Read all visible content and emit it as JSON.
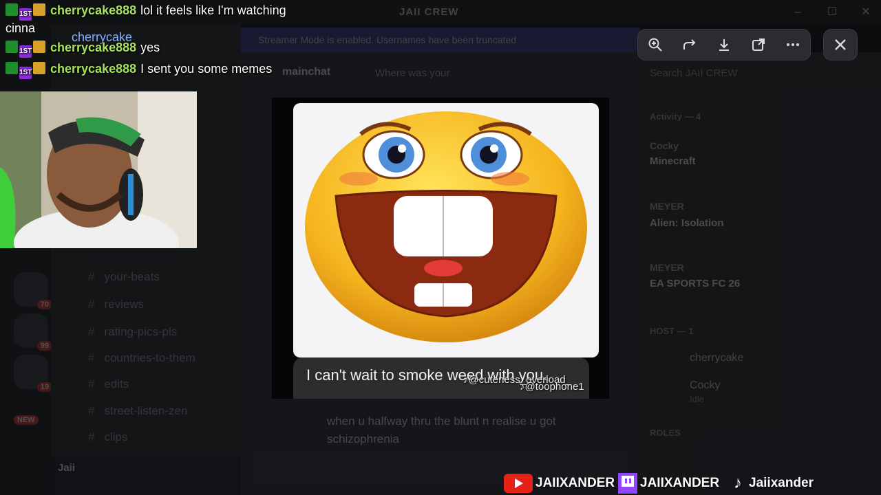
{
  "discord": {
    "app_title": "JAII CREW",
    "banner": "Streamer Mode is enabled. Usernames have been truncated",
    "chat_title": "mainchat",
    "chat_topic": "Where was your",
    "channels": [
      "your-beats",
      "reviews",
      "rating-pics-pls",
      "countries-to-them",
      "edits",
      "street-listen-zen",
      "clips"
    ],
    "guild_badges": [
      "70",
      "99",
      "19",
      "NEW"
    ],
    "user_panel_name": "Jaii",
    "chat_message": "when u halfway thru the blunt n realise u got schizophrenia",
    "member_search": "Search JAII CREW",
    "activity_label": "Activity — 4",
    "activities": [
      {
        "user": "Cocky",
        "game": "Minecraft"
      },
      {
        "user": "MEYER",
        "game": "Alien: Isolation"
      },
      {
        "user": "MEYER",
        "game": "EA SPORTS FC 26"
      }
    ],
    "online_label": "HOST — 1",
    "members": [
      {
        "name": "cherrycake",
        "sub": ""
      },
      {
        "name": "Cocky",
        "sub": "Idle"
      }
    ],
    "roles_label": "ROLES"
  },
  "viewer": {
    "toolbar": [
      {
        "icon": "zoom-in-icon"
      },
      {
        "icon": "forward-icon"
      },
      {
        "icon": "download-icon"
      },
      {
        "icon": "open-external-icon"
      },
      {
        "icon": "more-icon"
      }
    ],
    "close_icon": "close-icon",
    "meme_caption": "I can't wait to smoke weed with you.",
    "tiktok_handle_1": "♪@cuteness_overload_",
    "tiktok_handle_2": "♪@toophone1"
  },
  "stream_chat": {
    "lines": [
      {
        "user": "cherrycake888",
        "text": "lol it feels like I'm watching"
      },
      {
        "user": "cherrycake888",
        "text": "yes"
      },
      {
        "user": "cherrycake888",
        "text": "I sent you some memes"
      }
    ],
    "wrap_text": "cinna",
    "overlay_name": "cherrycake",
    "badge_1st": "1ST"
  },
  "socials": {
    "youtube": "JAIIXANDER",
    "twitch": "JAIIXANDER",
    "tiktok": "Jaiixander"
  },
  "colors": {
    "chat_username": "#a6e35a",
    "youtube": "#e62117",
    "twitch": "#9146ff",
    "emoji_face": "#f5b41e"
  }
}
